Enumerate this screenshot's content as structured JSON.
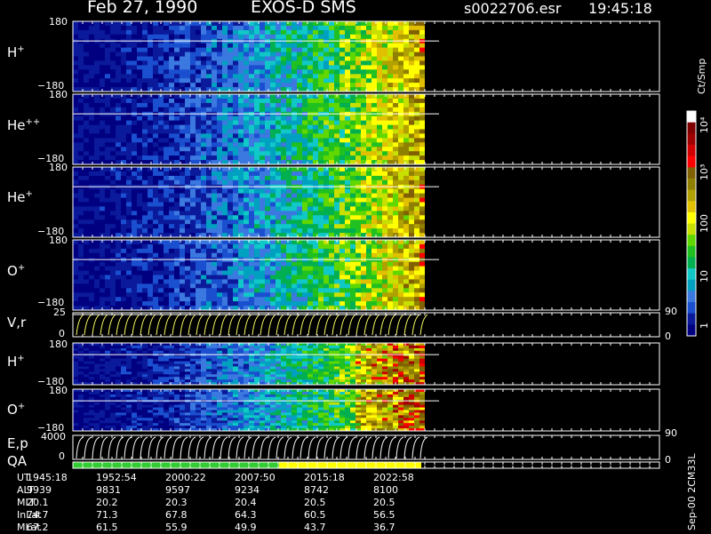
{
  "header": {
    "date": "Feb 27, 1990",
    "instrument": "EXOS-D SMS",
    "file": "s0022706.esr",
    "time": "19:45:18"
  },
  "side_labels": {
    "units": "Ct/Smp",
    "version": "Sep-00 2CM33L"
  },
  "colors": {
    "background": "#000000",
    "axis": "#ffffff",
    "trace": "#ffffff",
    "vr_trace": "#ffff66",
    "qa_good": "#33cc33",
    "qa_caution": "#ffff00"
  },
  "panels": [
    {
      "species": "H",
      "charge": "+",
      "top_tick": "180",
      "bottom_tick": "−180"
    },
    {
      "species": "He",
      "charge": "++",
      "top_tick": "180",
      "bottom_tick": "−180"
    },
    {
      "species": "He",
      "charge": "+",
      "top_tick": "180",
      "bottom_tick": "−180"
    },
    {
      "species": "O",
      "charge": "+",
      "top_tick": "180",
      "bottom_tick": "−180"
    },
    {
      "species": "V,r",
      "charge": "",
      "top_tick": "25",
      "bottom_tick": "0",
      "right_top": "90",
      "right_bottom": "0"
    },
    {
      "species": "H",
      "charge": "+",
      "top_tick": "180",
      "bottom_tick": "−180"
    },
    {
      "species": "O",
      "charge": "+",
      "top_tick": "180",
      "bottom_tick": "−180"
    },
    {
      "species": "E,p",
      "charge": "",
      "top_tick": "4000",
      "bottom_tick": "0",
      "right_top": "90",
      "right_bottom": "0"
    },
    {
      "species": "QA",
      "charge": ""
    }
  ],
  "colorbar": {
    "labels": [
      "10⁴",
      "10³",
      "100",
      "10",
      "1"
    ],
    "stops": [
      "#000080",
      "#0a1a9a",
      "#1a4fcf",
      "#3b78e0",
      "#00a0c0",
      "#10c8c8",
      "#00b050",
      "#20c020",
      "#60d800",
      "#c8e000",
      "#ffff00",
      "#e0c000",
      "#b0a000",
      "#908000",
      "#806000",
      "#ff0000",
      "#d00000",
      "#a00000",
      "#800000",
      "#ffffff"
    ]
  },
  "footer": {
    "row_labels": [
      "UT",
      "ALT",
      "MLT",
      "InLat",
      "MLat"
    ],
    "columns": [
      [
        "1945:18",
        "9939",
        "20.1",
        "74.7",
        "67.2"
      ],
      [
        "1952:54",
        "9831",
        "20.2",
        "71.3",
        "61.5"
      ],
      [
        "2000:22",
        "9597",
        "20.3",
        "67.8",
        "55.9"
      ],
      [
        "2007:50",
        "9234",
        "20.4",
        "64.3",
        "49.9"
      ],
      [
        "2015:18",
        "8742",
        "20.5",
        "60.5",
        "43.7"
      ],
      [
        "2022:58",
        "8100",
        "20.5",
        "56.5",
        "36.7"
      ]
    ]
  },
  "chart_data": {
    "type": "heatmap",
    "title": "Feb 27, 1990   EXOS-D SMS",
    "x": [
      "1945:18",
      "1952:54",
      "2000:22",
      "2007:50",
      "2015:18",
      "2022:58"
    ],
    "xlabel": "UT",
    "data_extent_ut": "2022:58",
    "panels": [
      {
        "name": "H+",
        "ylim": [
          -180,
          180
        ]
      },
      {
        "name": "He++",
        "ylim": [
          -180,
          180
        ]
      },
      {
        "name": "He+",
        "ylim": [
          -180,
          180
        ]
      },
      {
        "name": "O+",
        "ylim": [
          -180,
          180
        ]
      },
      {
        "name": "V,r",
        "ylim": [
          0,
          25
        ],
        "right_ylim": [
          0,
          90
        ]
      },
      {
        "name": "H+",
        "ylim": [
          -180,
          180
        ]
      },
      {
        "name": "O+",
        "ylim": [
          -180,
          180
        ]
      },
      {
        "name": "E,p",
        "ylim": [
          0,
          4000
        ],
        "right_ylim": [
          0,
          90
        ]
      },
      {
        "name": "QA"
      }
    ],
    "colorbar": {
      "label": "Ct/Smp",
      "scale": "log",
      "range": [
        1,
        10000
      ]
    }
  }
}
